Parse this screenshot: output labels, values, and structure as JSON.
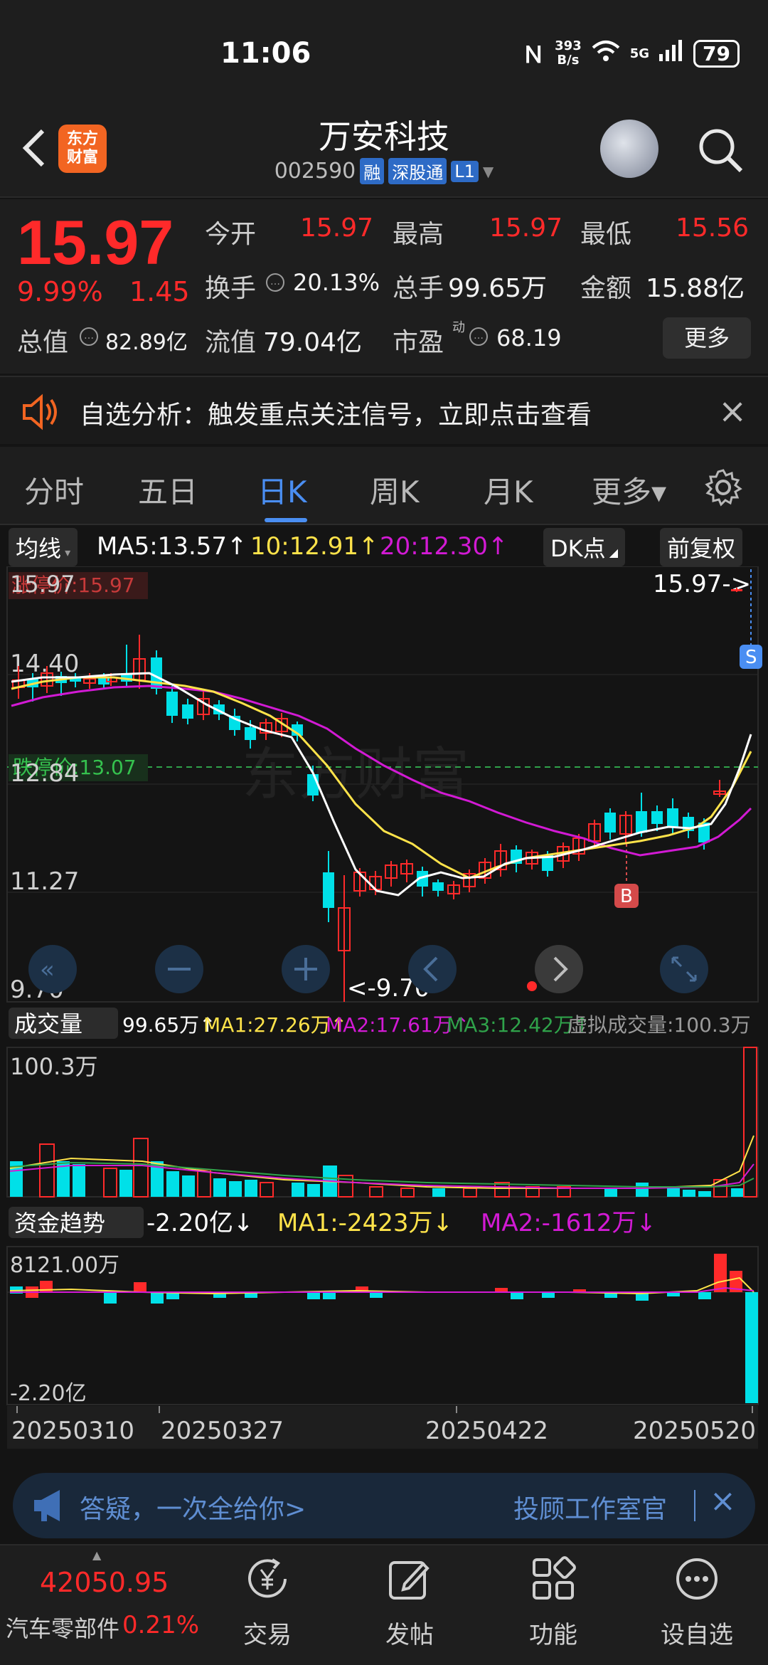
{
  "status": {
    "time": "11:06",
    "net_speed_value": "393",
    "net_speed_unit": "B/s",
    "network": "5G",
    "battery": "79"
  },
  "header": {
    "logo_line1": "东方",
    "logo_line2": "财富",
    "name": "万安科技",
    "code": "002590",
    "tags": [
      "融",
      "深股通",
      "L1"
    ]
  },
  "quote": {
    "price": "15.97",
    "pct": "9.99%",
    "change": "1.45",
    "open_label": "今开",
    "open": "15.97",
    "high_label": "最高",
    "high": "15.97",
    "low_label": "最低",
    "low": "15.56",
    "turnover_label": "换手",
    "turnover": "20.13%",
    "volume_label": "总手",
    "volume": "99.65万",
    "amount_label": "金额",
    "amount": "15.88亿",
    "mcap_label": "总值",
    "mcap": "82.89亿",
    "float_label": "流值",
    "float": "79.04亿",
    "pe_label": "市盈",
    "pe_sup": "动",
    "pe": "68.19",
    "more_label": "更多"
  },
  "alert": {
    "text": "自选分析：触发重点关注信号，立即点击查看"
  },
  "tabs": [
    "分时",
    "五日",
    "日K",
    "周K",
    "月K",
    "更多▾"
  ],
  "active_tab": "日K",
  "ma_row": {
    "selector": "均线",
    "ma5": "MA5:13.57↑",
    "ma10": "10:12.91↑",
    "ma20": "20:12.30↑",
    "dk": "DK点",
    "fq": "前复权"
  },
  "kline": {
    "limit_up": "涨停价:15.97",
    "limit_down": "跌停价:13.07",
    "axis_labels": [
      "15.97",
      "14.40",
      "12.84",
      "11.27",
      "9.70"
    ],
    "last_price_tag": "15.97->",
    "low_tag": "<-9.70",
    "sell_mark": "S",
    "buy_mark": "B",
    "watermark": "东方财富"
  },
  "volume": {
    "selector": "成交量",
    "value": "99.65万↑",
    "ma1": "MA1:27.26万↑",
    "ma2": "MA2:17.61万↑",
    "ma3": "MA3:12.42万↑",
    "virtual": "虚拟成交量:100.3万",
    "axis_top": "100.3万"
  },
  "fund": {
    "selector": "资金趋势",
    "value": "-2.20亿↓",
    "ma1": "MA1:-2423万↓",
    "ma2": "MA2:-1612万↓",
    "axis_top": "8121.00万",
    "axis_bottom": "-2.20亿"
  },
  "dates": [
    "20250310",
    "20250327",
    "20250422",
    "20250520"
  ],
  "banner": {
    "text": "答疑，一次全给你>",
    "right": "投顾工作室官"
  },
  "bottom": {
    "index_value": "42050.95",
    "index_name": "汽车零部件",
    "index_pct": "0.21%",
    "nav": [
      "交易",
      "发帖",
      "功能",
      "设自选"
    ]
  },
  "colors": {
    "up": "#ff2a2a",
    "down": "#00e0e8",
    "ma5": "#ffffff",
    "ma10": "#ffe34a",
    "ma20": "#d21ad4",
    "accent": "#4a8ef2"
  }
}
